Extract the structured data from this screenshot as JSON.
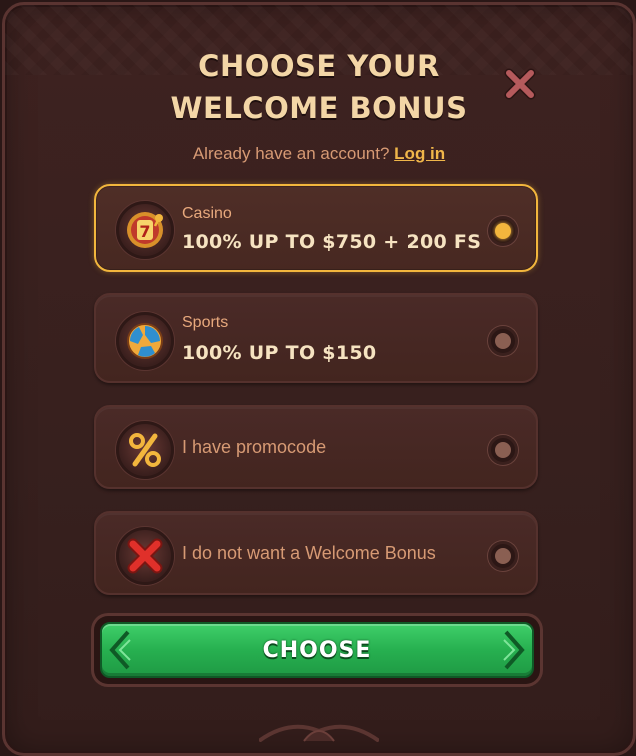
{
  "modal": {
    "title_line1": "CHOOSE YOUR",
    "title_line2": "WELCOME BONUS",
    "close_icon": "close-x-icon",
    "subtitle_text": "Already have an account?",
    "login_link": "Log in"
  },
  "options": [
    {
      "label": "Casino",
      "title": "100% UP TO $750 + 200 FS",
      "icon": "slot-machine-icon",
      "selected": true
    },
    {
      "label": "Sports",
      "title": "100% UP TO $150",
      "icon": "soccer-ball-icon",
      "selected": false
    },
    {
      "text": "I have promocode",
      "icon": "percent-icon",
      "selected": false
    },
    {
      "text": "I do not want a Welcome Bonus",
      "icon": "red-x-icon",
      "selected": false
    }
  ],
  "choose_button": {
    "label": "CHOOSE"
  },
  "colors": {
    "accent": "#f2b63d",
    "button_green": "#27b050",
    "background": "#37201e",
    "title": "#f3d6a6"
  }
}
